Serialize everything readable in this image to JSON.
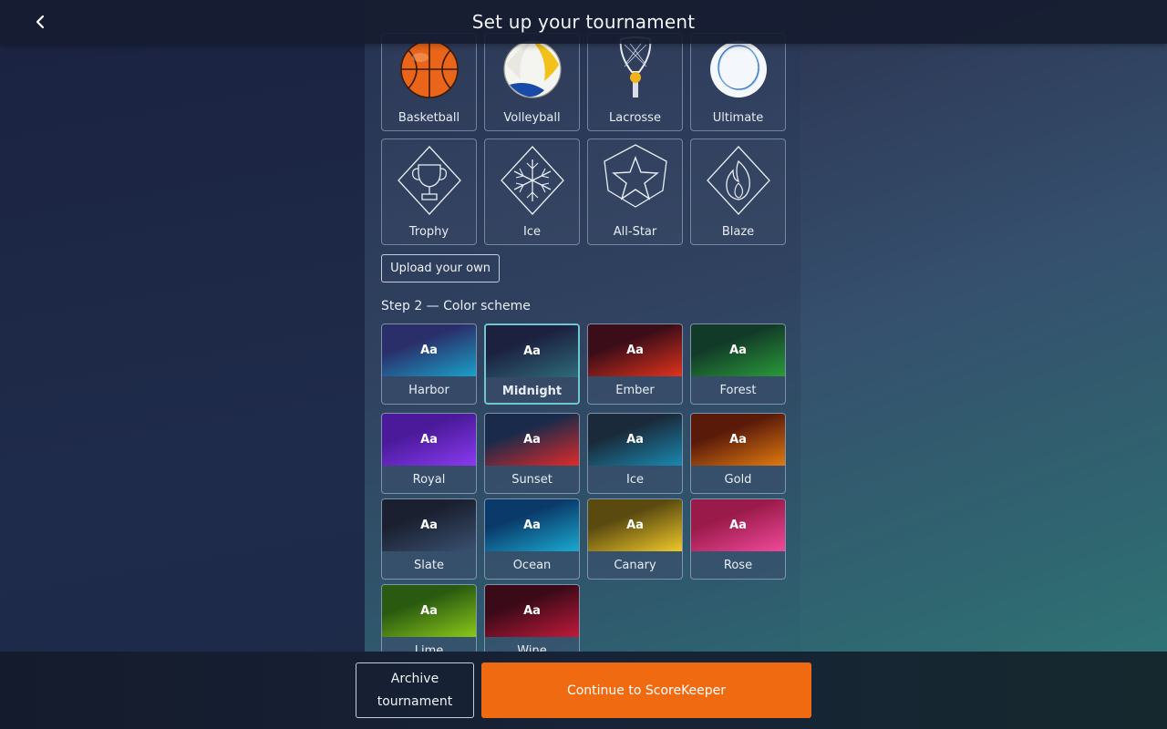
{
  "header": {
    "title": "Set up your tournament",
    "back_icon": "chevron-left-icon"
  },
  "icons": {
    "row1": [
      {
        "label": "Basketball",
        "icon": "basketball-icon"
      },
      {
        "label": "Volleyball",
        "icon": "volleyball-icon"
      },
      {
        "label": "Lacrosse",
        "icon": "lacrosse-icon"
      },
      {
        "label": "Ultimate",
        "icon": "disc-icon"
      }
    ],
    "row2": [
      {
        "label": "Trophy",
        "icon": "trophy-icon"
      },
      {
        "label": "Ice",
        "icon": "snowflake-icon"
      },
      {
        "label": "All-Star",
        "icon": "star-icon"
      },
      {
        "label": "Blaze",
        "icon": "flame-icon"
      }
    ],
    "upload_label": "Upload your own"
  },
  "color_scheme": {
    "title": "Step 2 — Color scheme",
    "sample_text": "Aa",
    "selected": "Midnight",
    "schemes": [
      {
        "name": "Harbor",
        "from": "#2a2f6a",
        "to": "#1aa0c8"
      },
      {
        "name": "Midnight",
        "from": "#1c2140",
        "to": "#2e6a78"
      },
      {
        "name": "Ember",
        "from": "#3a0d18",
        "to": "#e0321c"
      },
      {
        "name": "Forest",
        "from": "#123a28",
        "to": "#2a9a3a"
      },
      {
        "name": "Royal",
        "from": "#4a1a9a",
        "to": "#8a3af0"
      },
      {
        "name": "Sunset",
        "from": "#1a2a4a",
        "to": "#e02a2a"
      },
      {
        "name": "Ice",
        "from": "#1a2a3a",
        "to": "#1a88b0"
      },
      {
        "name": "Gold",
        "from": "#5a1a0a",
        "to": "#e07a10"
      },
      {
        "name": "Slate",
        "from": "#1a2030",
        "to": "#3a5070"
      },
      {
        "name": "Ocean",
        "from": "#0a3a6a",
        "to": "#1aaad0"
      },
      {
        "name": "Canary",
        "from": "#5a4a10",
        "to": "#f0c82a"
      },
      {
        "name": "Rose",
        "from": "#9a1a4a",
        "to": "#f04a9a"
      },
      {
        "name": "Lime",
        "from": "#2a5a10",
        "to": "#8ac81a"
      },
      {
        "name": "Wine",
        "from": "#3a0a18",
        "to": "#c01a3a"
      }
    ]
  },
  "footer": {
    "archive_line1": "Archive",
    "archive_line2": "tournament",
    "continue_label": "Continue to ScoreKeeper"
  }
}
